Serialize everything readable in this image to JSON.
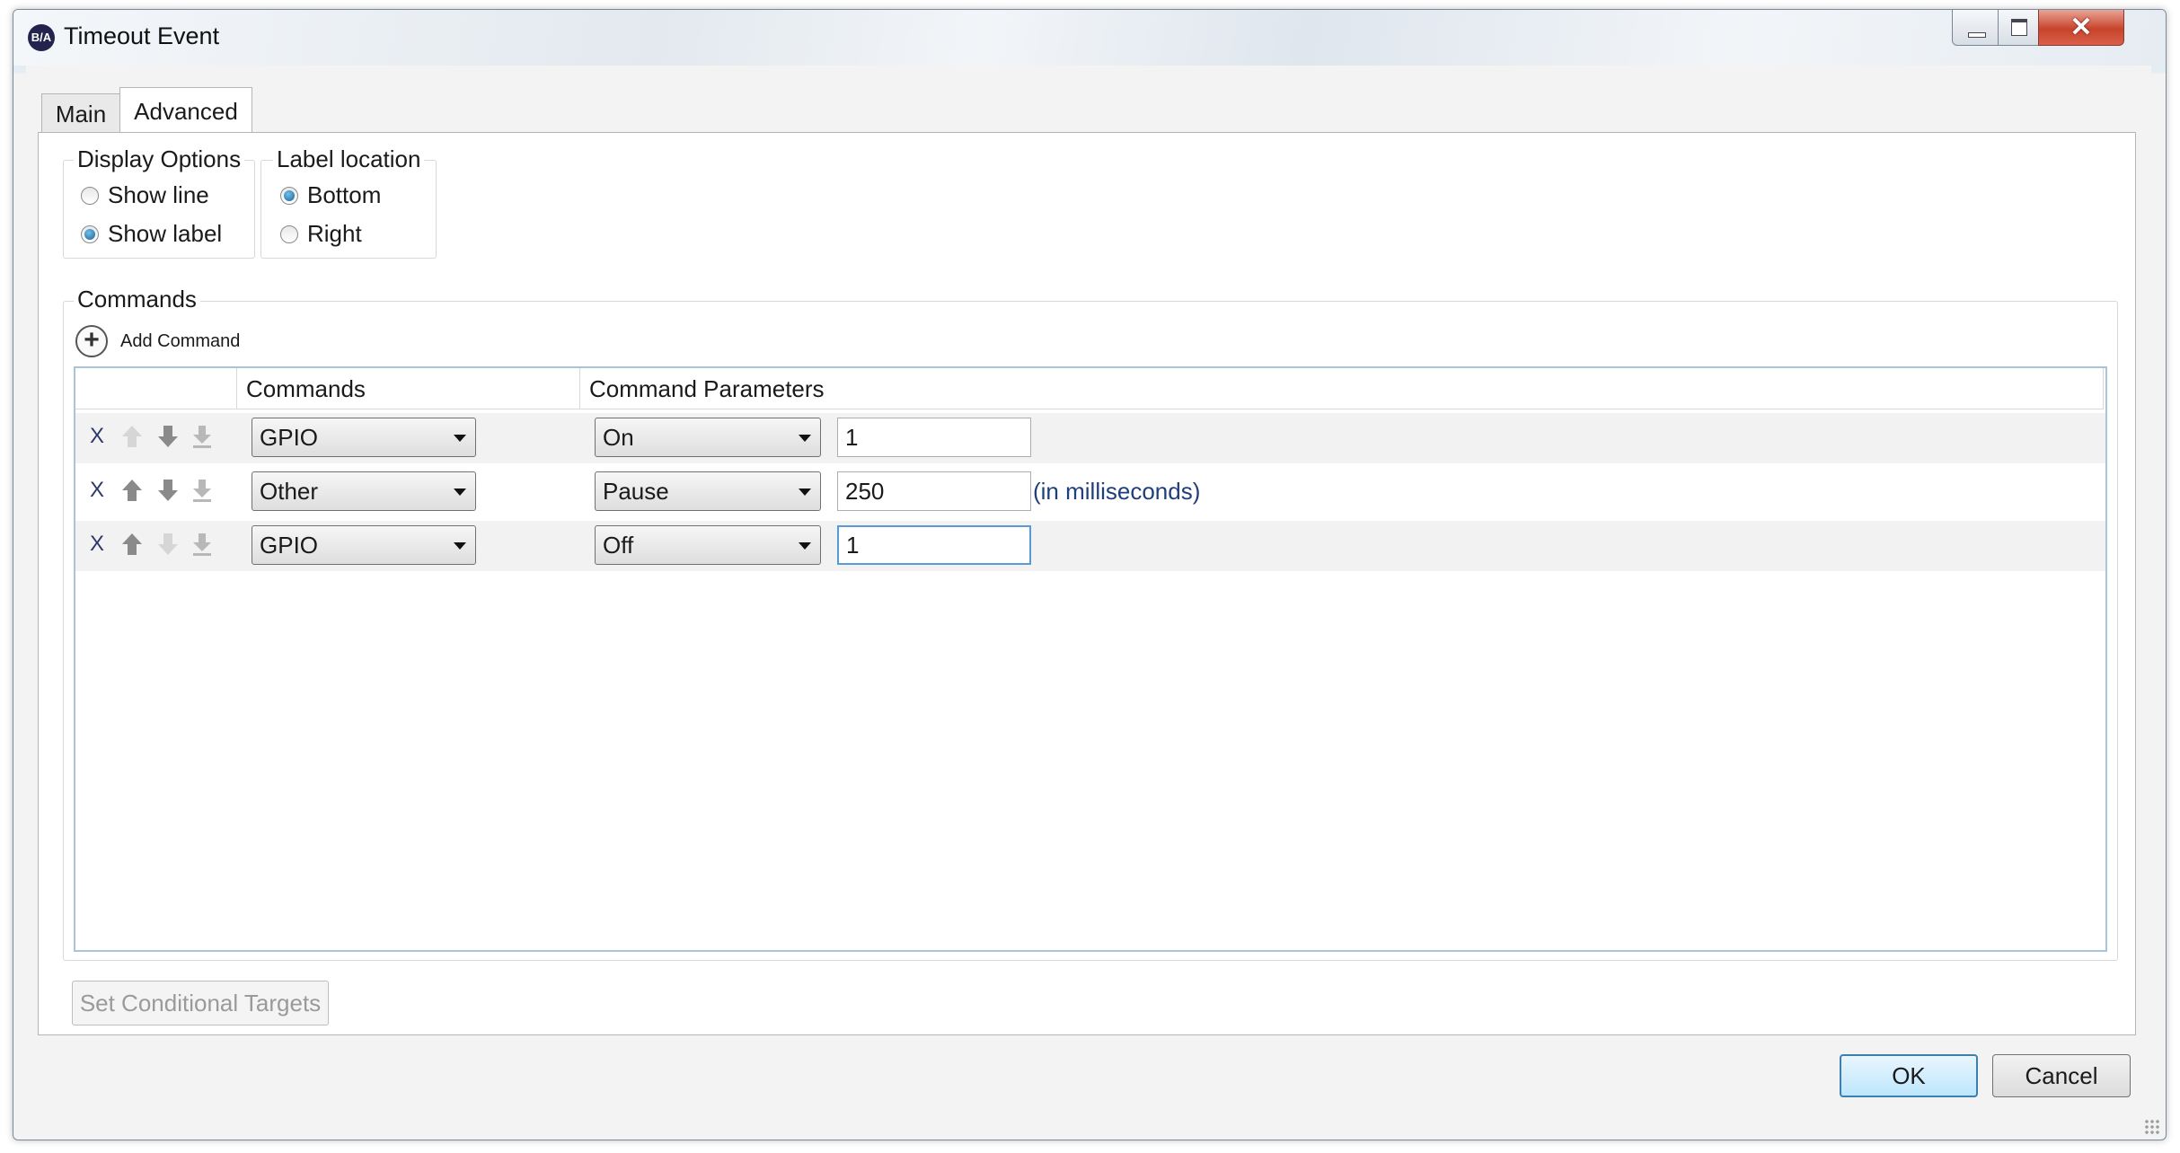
{
  "window": {
    "app_icon_text": "B/A",
    "title": "Timeout Event",
    "close_glyph": "✕"
  },
  "tabs": [
    {
      "label": "Main",
      "selected": false
    },
    {
      "label": "Advanced",
      "selected": true
    }
  ],
  "display_options": {
    "title": "Display Options",
    "options": [
      {
        "label": "Show line",
        "checked": false
      },
      {
        "label": "Show label",
        "checked": true
      }
    ]
  },
  "label_location": {
    "title": "Label location",
    "options": [
      {
        "label": "Bottom",
        "checked": true
      },
      {
        "label": "Right",
        "checked": false
      }
    ]
  },
  "commands": {
    "title": "Commands",
    "add_label": "Add Command",
    "add_glyph": "+",
    "columns": [
      "Commands",
      "Command Parameters"
    ],
    "rows": [
      {
        "delete": "X",
        "command": "GPIO",
        "parameter": "On",
        "value": "1",
        "unit": ""
      },
      {
        "delete": "X",
        "command": "Other",
        "parameter": "Pause",
        "value": "250",
        "unit": "(in milliseconds)"
      },
      {
        "delete": "X",
        "command": "GPIO",
        "parameter": "Off",
        "value": "1",
        "unit": ""
      }
    ]
  },
  "footer": {
    "set_conditional": "Set Conditional Targets",
    "ok": "OK",
    "cancel": "Cancel"
  },
  "colors": {
    "accent": "#3c7fb1",
    "close_button": "#c8432b",
    "link_text": "#1f3f7a"
  }
}
